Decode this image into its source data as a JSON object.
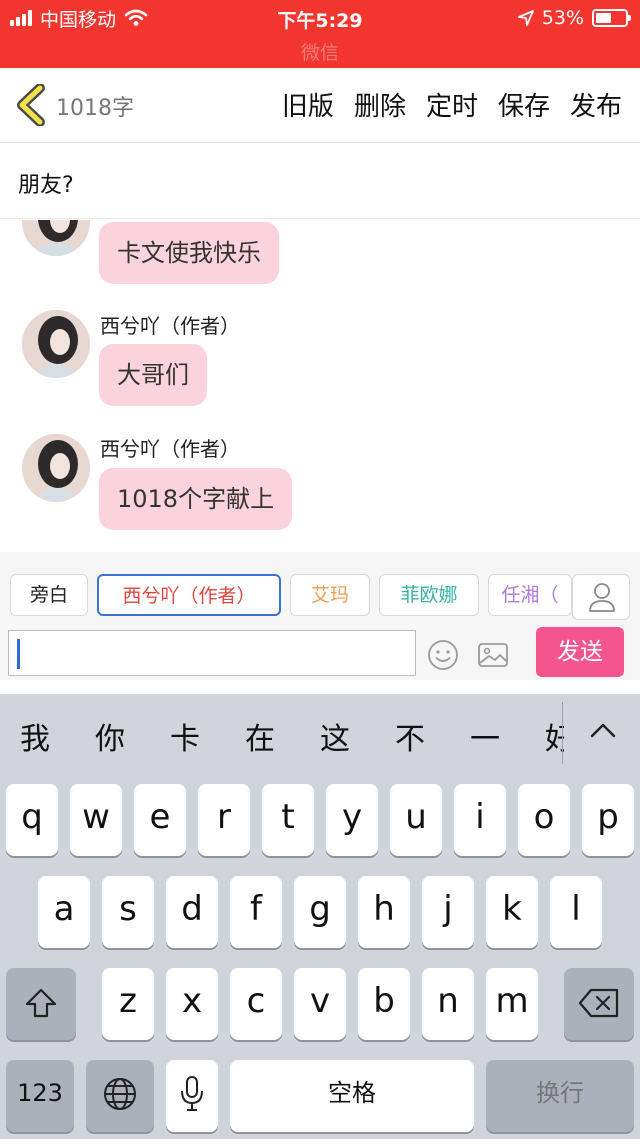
{
  "status_bar": {
    "carrier": "中国移动",
    "time": "下午5:29",
    "battery": "53%",
    "battery_level": 0.53,
    "app_name": "微信"
  },
  "nav": {
    "word_count": "1018字",
    "actions": [
      "旧版",
      "删除",
      "定时",
      "保存",
      "发布"
    ]
  },
  "story_title": "朋友?",
  "messages": [
    {
      "author": "",
      "text": "卡文使我快乐"
    },
    {
      "author": "西兮吖（作者）",
      "text": "大哥们"
    },
    {
      "author": "西兮吖（作者）",
      "text": "1018个字献上"
    }
  ],
  "roles": [
    {
      "label": "旁白",
      "color": "#222222",
      "selected": false
    },
    {
      "label": "西兮吖（作者）",
      "color": "#e0453d",
      "selected": true
    },
    {
      "label": "艾玛",
      "color": "#f19e53",
      "selected": false
    },
    {
      "label": "菲欧娜",
      "color": "#37b3a6",
      "selected": false
    },
    {
      "label": "任湘（",
      "color": "#b07ad9",
      "selected": false
    }
  ],
  "composer": {
    "value": "",
    "send_label": "发送"
  },
  "keyboard": {
    "candidates": [
      "我",
      "你",
      "卡",
      "在",
      "这",
      "不",
      "一",
      "好"
    ],
    "row1": [
      "q",
      "w",
      "e",
      "r",
      "t",
      "y",
      "u",
      "i",
      "o",
      "p"
    ],
    "row2": [
      "a",
      "s",
      "d",
      "f",
      "g",
      "h",
      "j",
      "k",
      "l"
    ],
    "row3": [
      "z",
      "x",
      "c",
      "v",
      "b",
      "n",
      "m"
    ],
    "numbers_label": "123",
    "space_label": "空格",
    "return_label": "换行"
  },
  "colors": {
    "status_bar": "#f2352f",
    "bubble": "#fbd3dc",
    "send_button": "#f5558d",
    "accent_border": "#3b74d1"
  }
}
